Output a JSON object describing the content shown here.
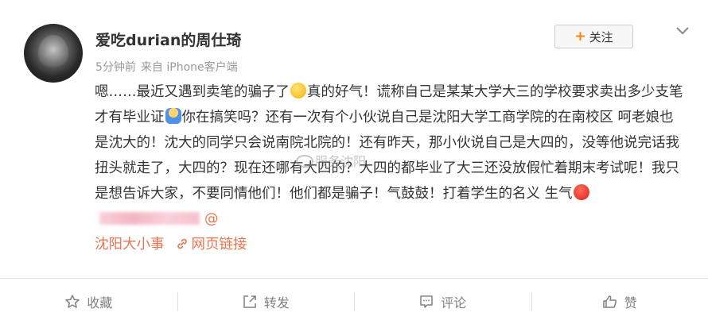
{
  "post": {
    "username": "爱吃durian的周仕琦",
    "time": "5分钟前",
    "source": "来自 iPhone客户端",
    "follow_label": "关注",
    "content": {
      "part1": "嗯……最近又遇到卖笔的骗子了",
      "part2": "真的好气！谎称自己是某某大学大三的学校要求卖出多少支笔才有毕业证",
      "part3": "你在搞笑吗？还有一次有个小伙说自己是沈阳大学工商学院的在南校区 呵老娘也是沈大的！沈大的同学只会说南院北院的！还有昨天，那小伙说自己是大四的，没等他说完话我扭头就走了，大四的？现在还哪有大四的？大四的都毕业了大三还没放假忙着期末考试呢！我只是想告诉大家，不要同情他们！他们都是骗子！气鼓鼓！打着学生的名义 生气",
      "at_symbol": "@",
      "topic": "沈阳大小事",
      "link_label": "网页链接"
    },
    "watermark": "服务沈阳"
  },
  "actions": {
    "favorite": "收藏",
    "repost": "转发",
    "comment": "评论",
    "like": "赞"
  },
  "colors": {
    "link": "#eb7350",
    "follow_plus": "#ff8200",
    "meta": "#999999",
    "action": "#808080"
  }
}
